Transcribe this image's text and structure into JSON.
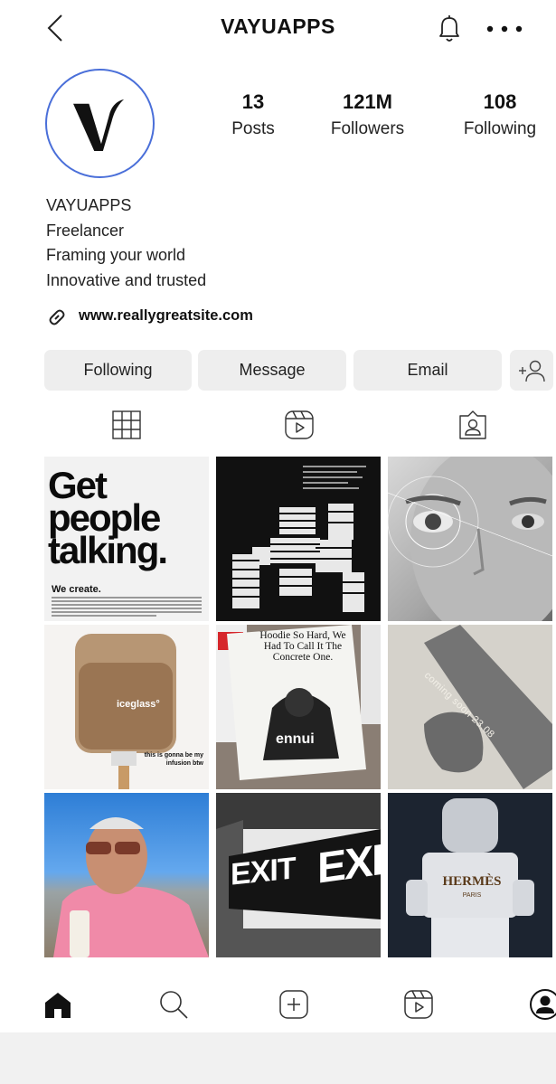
{
  "header": {
    "title": "VAYUAPPS"
  },
  "profile": {
    "avatar_letter": "V",
    "stats": [
      {
        "value": "13",
        "label": "Posts"
      },
      {
        "value": "121M",
        "label": "Followers"
      },
      {
        "value": "108",
        "label": "Following"
      }
    ],
    "bio": [
      "VAYUAPPS",
      "Freelancer",
      "Framing your world",
      "Innovative and trusted"
    ],
    "website": "www.reallygreatsite.com"
  },
  "actions": {
    "following": "Following",
    "message": "Message",
    "email": "Email"
  },
  "posts": {
    "p1": {
      "headline_1": "Get",
      "headline_2": "people",
      "headline_3": "talking.",
      "subhead": "We create."
    },
    "p4": {
      "brand": "iceglass°",
      "caption": "this is gonna be my infusion btw"
    },
    "p5": {
      "headline": "Hoodie So Hard, We Had To Call It The Concrete One.",
      "brand": "ennui"
    },
    "p6": {
      "text": "coming soon 23.08"
    },
    "p8": {
      "text_1": "EXIT",
      "text_2": "EXIT"
    },
    "p9": {
      "brand": "HERMÈS",
      "city": "PARIS"
    }
  },
  "colors": {
    "accent": "#4a6fd9",
    "button_bg": "#eeeeee",
    "text": "#111111"
  }
}
